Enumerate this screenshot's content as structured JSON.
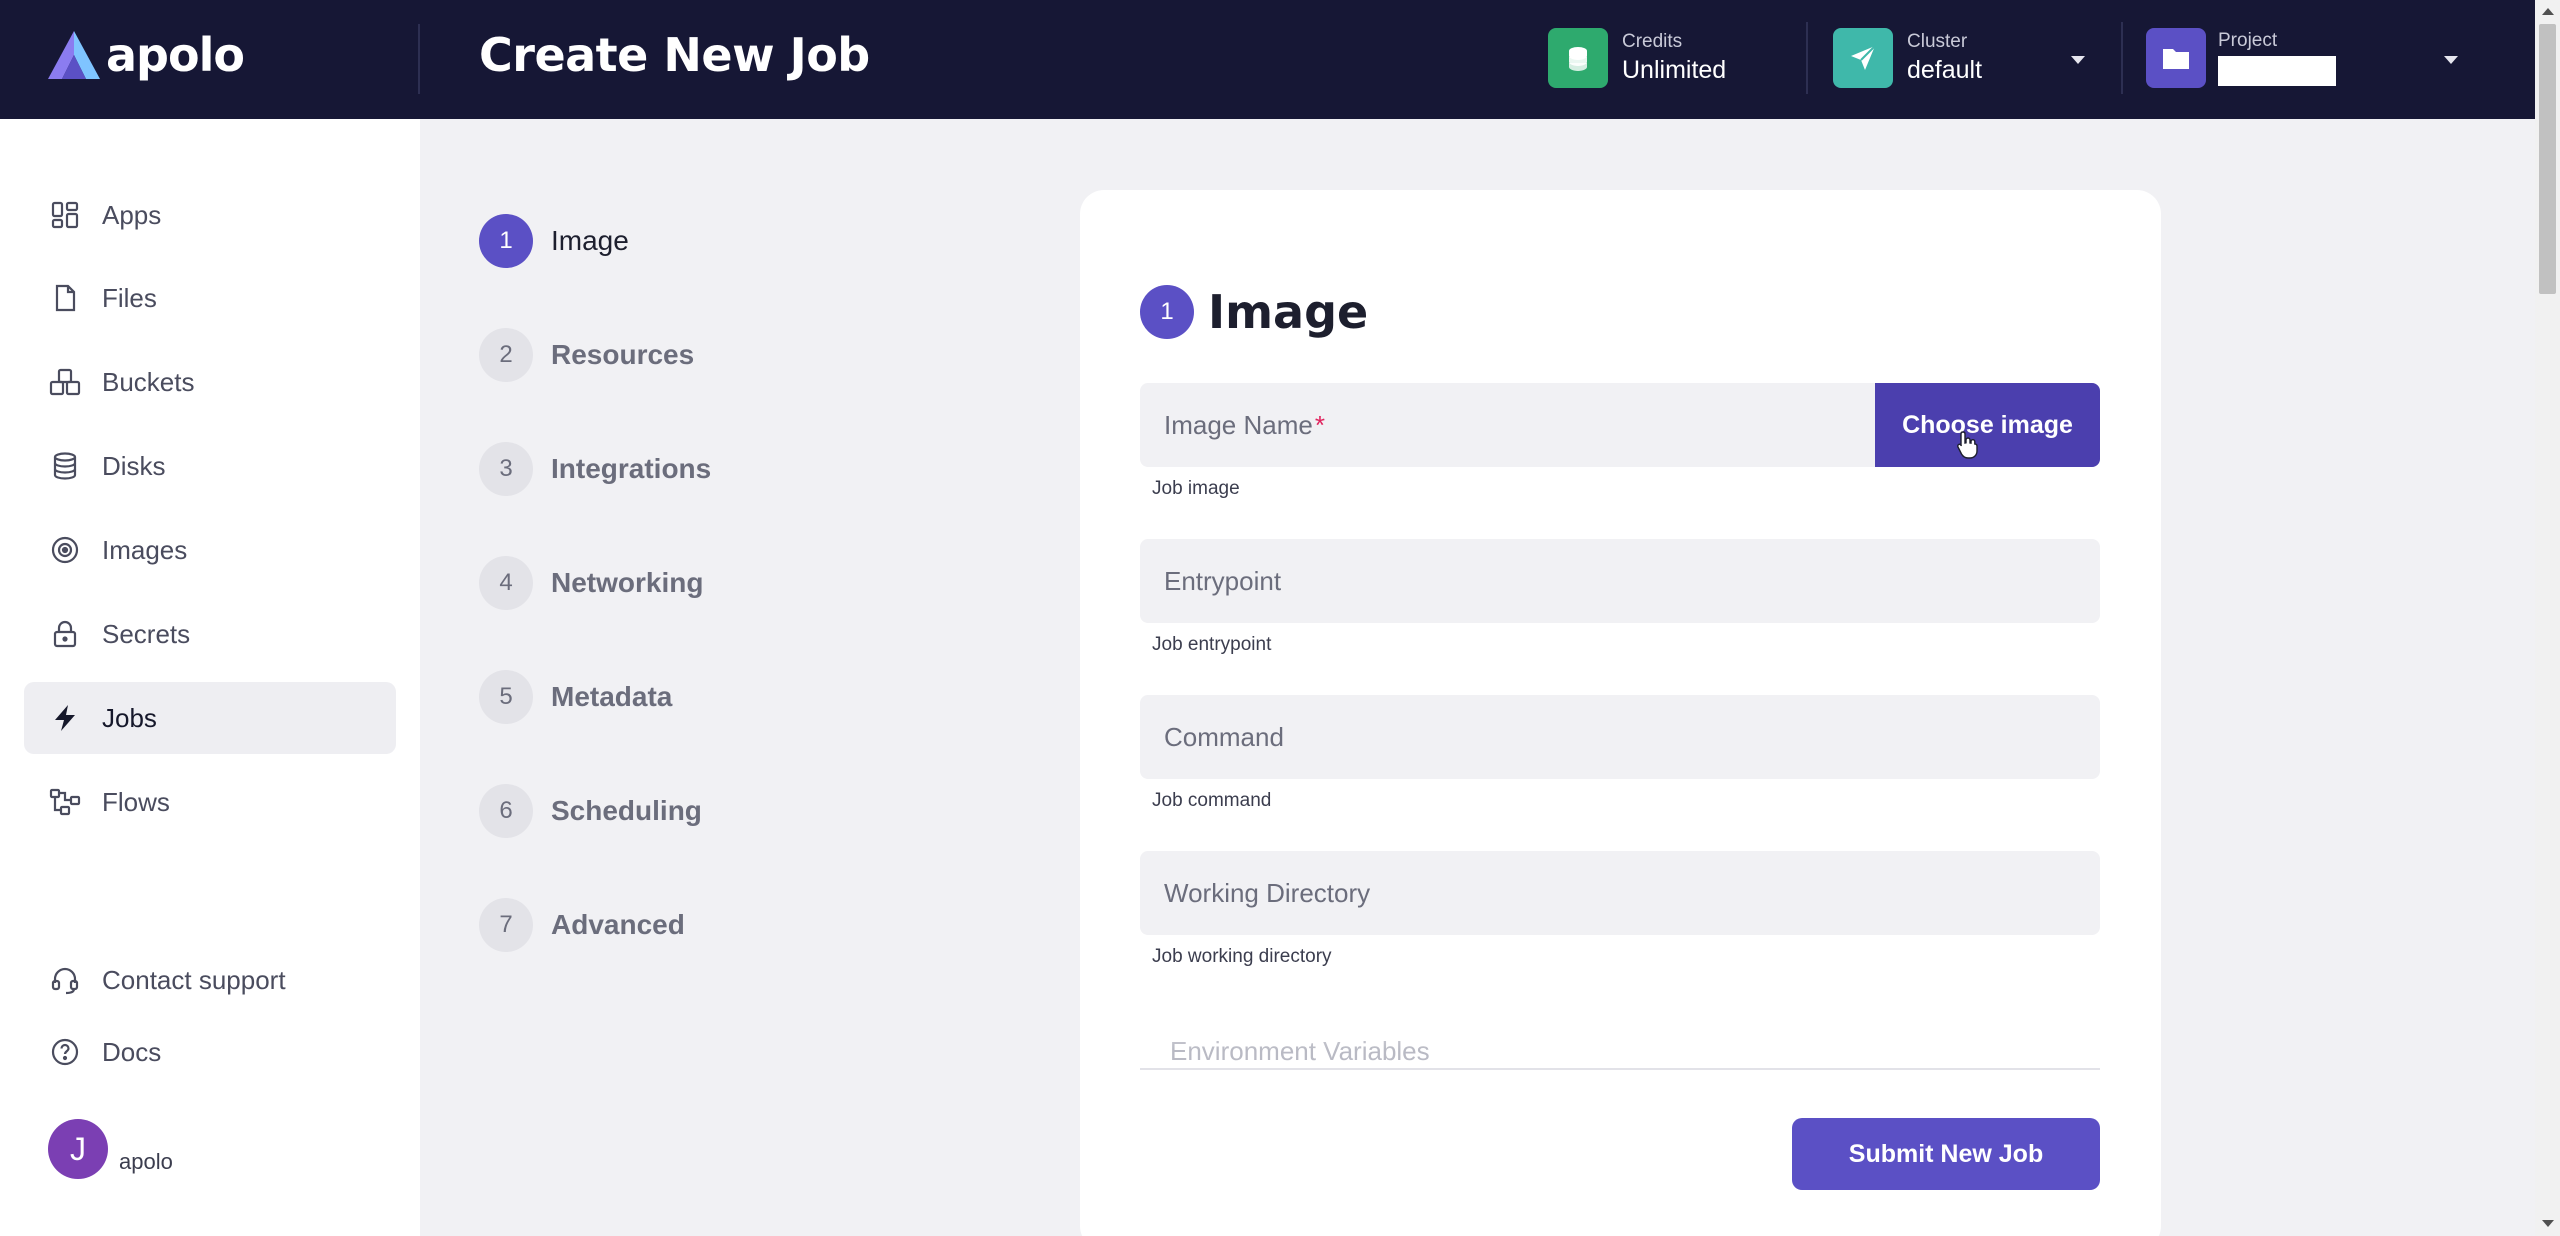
{
  "header": {
    "brand": "apolo",
    "title": "Create New Job",
    "credits": {
      "label": "Credits",
      "value": "Unlimited"
    },
    "cluster": {
      "label": "Cluster",
      "value": "default"
    },
    "project": {
      "label": "Project"
    }
  },
  "sidebar": {
    "items": [
      {
        "label": "Apps",
        "icon": "apps-grid-icon"
      },
      {
        "label": "Files",
        "icon": "file-icon"
      },
      {
        "label": "Buckets",
        "icon": "bucket-icon"
      },
      {
        "label": "Disks",
        "icon": "database-icon"
      },
      {
        "label": "Images",
        "icon": "disc-icon"
      },
      {
        "label": "Secrets",
        "icon": "lock-icon"
      },
      {
        "label": "Jobs",
        "icon": "lightning-icon",
        "active": true
      },
      {
        "label": "Flows",
        "icon": "flow-icon"
      }
    ],
    "contact_support": "Contact support",
    "docs": "Docs",
    "user": {
      "initial": "J",
      "name": "apolo"
    }
  },
  "steps": [
    {
      "num": "1",
      "label": "Image",
      "active": true
    },
    {
      "num": "2",
      "label": "Resources"
    },
    {
      "num": "3",
      "label": "Integrations"
    },
    {
      "num": "4",
      "label": "Networking"
    },
    {
      "num": "5",
      "label": "Metadata"
    },
    {
      "num": "6",
      "label": "Scheduling"
    },
    {
      "num": "7",
      "label": "Advanced"
    }
  ],
  "form": {
    "step_num": "1",
    "title": "Image",
    "image_name": {
      "placeholder": "Image Name",
      "required_mark": "*",
      "helper": "Job image",
      "button": "Choose image"
    },
    "entrypoint": {
      "placeholder": "Entrypoint",
      "helper": "Job entrypoint"
    },
    "command": {
      "placeholder": "Command",
      "helper": "Job command"
    },
    "working_directory": {
      "placeholder": "Working Directory",
      "helper": "Job working directory"
    },
    "environment_variables": {
      "placeholder": "Environment Variables"
    },
    "submit": "Submit New Job"
  },
  "colors": {
    "header_bg": "#161735",
    "accent": "#5b50c5",
    "credits_tile": "#2eaa6e",
    "cluster_tile": "#3fb8aa",
    "project_tile": "#5b50c5"
  }
}
